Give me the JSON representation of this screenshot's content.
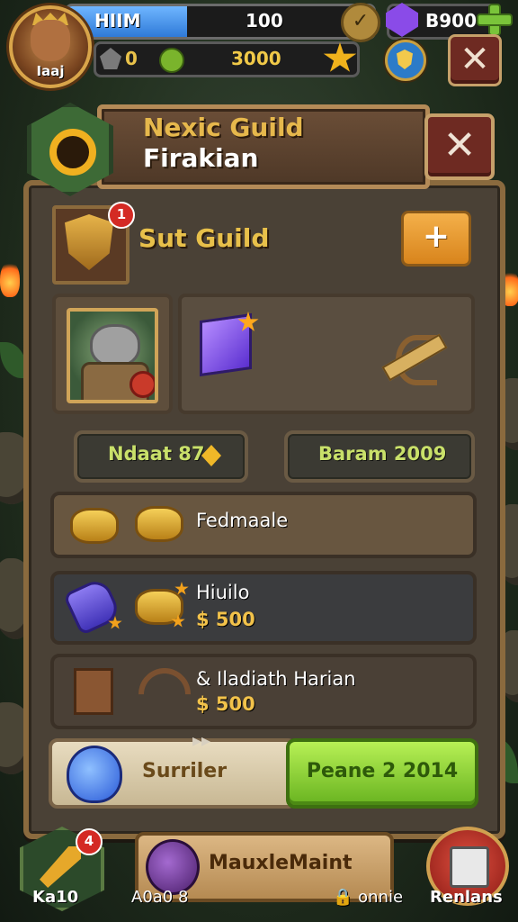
{
  "hud": {
    "player_name": "Iaaj",
    "hp_label": "HIIM",
    "hp_value": "100",
    "ore_value": "0",
    "gold_value": "3000",
    "gem_value": "B900",
    "close_label": "✕",
    "check_label": "✓"
  },
  "panel": {
    "title_line1": "Nexic Guild",
    "title_line2": "Firakian",
    "close_label": "✕",
    "guild_name": "Sut Guild",
    "crest_badge": "1",
    "add_label": "+",
    "stat_left": "Ndaat 87",
    "stat_right": "Baram 2009"
  },
  "rows": [
    {
      "label": "Fedmaale",
      "price": ""
    },
    {
      "label": "Hiuilo",
      "price": "$ 500"
    },
    {
      "label": "& Iladiath Harian",
      "price": "$ 500"
    }
  ],
  "actions": {
    "left_label": "Surriler",
    "right_label": "Peane 2 2014",
    "arrows": "▸▸"
  },
  "bottom_nav": {
    "left_badge": "4",
    "left_label": "Ka10",
    "mid_label": "A0a0 8",
    "plate_label": "MauxleMaint",
    "lock_label": "🔒 onnie",
    "right_label": "Renlans"
  },
  "colors": {
    "hp_bar": "#2f7ad8",
    "gold_text": "#f0c948",
    "gem": "#8a4be8",
    "close_red": "#6e2a22",
    "cta_green": "#68b320",
    "stat_text": "#c9e06a"
  },
  "hp_fill_fraction": 0.39,
  "icons": {
    "hud": [
      "player-avatar",
      "hp-check-icon",
      "ore-icon",
      "green-coin-icon",
      "gold-star-icon",
      "gem-icon",
      "add-green-icon",
      "shield-icon",
      "close-icon"
    ],
    "panel": [
      "guild-emblem-icon",
      "crest-shield-icon",
      "robot-character",
      "magic-cube-icon",
      "crossbow-icon",
      "diamond-icon",
      "scroll-icon",
      "bell-icon",
      "crate-icon",
      "bow-icon",
      "potion-icon"
    ],
    "bottom": [
      "quill-icon",
      "orb-icon",
      "document-icon"
    ]
  }
}
